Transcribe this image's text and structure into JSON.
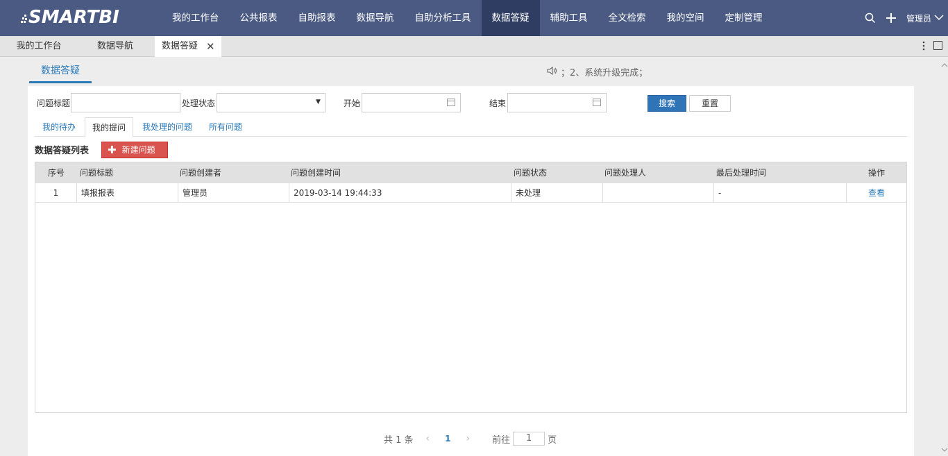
{
  "brand": {
    "logo_text": "SMARTBI"
  },
  "topnav": {
    "items": [
      "我的工作台",
      "公共报表",
      "自助报表",
      "数据导航",
      "自助分析工具",
      "数据答疑",
      "辅助工具",
      "全文检索",
      "我的空间",
      "定制管理"
    ],
    "active": "数据答疑",
    "user": "管理员"
  },
  "window_tabs": {
    "items": [
      "我的工作台",
      "数据导航",
      "数据答疑"
    ],
    "active": "数据答疑"
  },
  "page": {
    "tab_label": "数据答疑",
    "notice": "；2、系统升级完成；"
  },
  "filters": {
    "title_label": "问题标题",
    "title_value": "",
    "status_label": "处理状态",
    "status_value": "",
    "start_label": "开始",
    "start_value": "",
    "end_label": "结束",
    "end_value": "",
    "search_button": "搜索",
    "reset_button": "重置"
  },
  "subtabs": {
    "items": [
      "我的待办",
      "我的提问",
      "我处理的问题",
      "所有问题"
    ],
    "active": "我的提问"
  },
  "list": {
    "title": "数据答疑列表",
    "new_button": "新建问题",
    "columns": [
      "序号",
      "问题标题",
      "问题创建者",
      "问题创建时间",
      "问题状态",
      "问题处理人",
      "最后处理时间",
      "操作"
    ],
    "rows": [
      {
        "index": "1",
        "title": "填报报表",
        "creator": "管理员",
        "created": "2019-03-14 19:44:33",
        "status": "未处理",
        "handler": "",
        "last_time": "-",
        "action": "查看"
      }
    ]
  },
  "pager": {
    "total_text": "共 1 条",
    "current_page": "1",
    "goto_prefix": "前往",
    "goto_value": "1",
    "goto_suffix": "页"
  },
  "colors": {
    "nav_bg": "#4a5a82",
    "nav_active": "#2f3d63",
    "accent": "#2a7ab8",
    "danger": "#d9534f",
    "primary": "#2f74b6"
  }
}
